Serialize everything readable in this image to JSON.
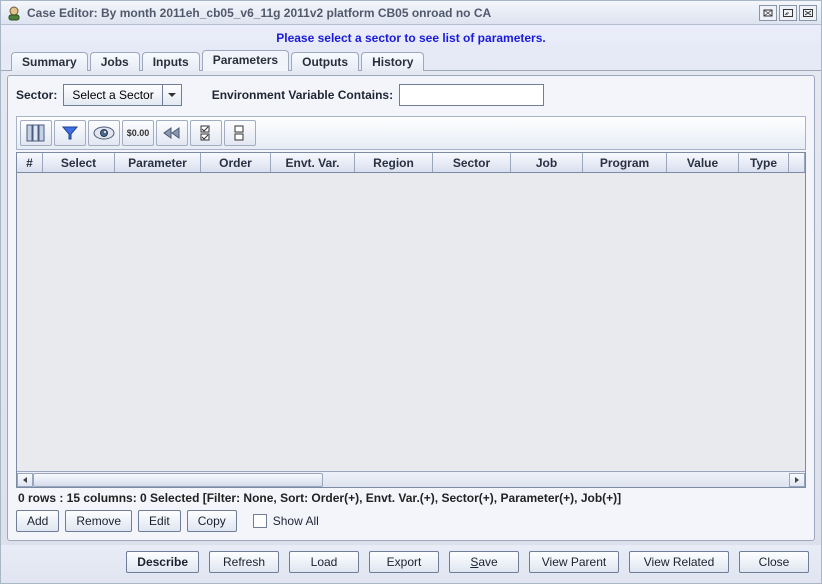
{
  "title": "Case Editor: By month 2011eh_cb05_v6_11g 2011v2 platform CB05 onroad no CA",
  "banner": "Please select a sector to see list of parameters.",
  "tabs": [
    {
      "label": "Summary"
    },
    {
      "label": "Jobs"
    },
    {
      "label": "Inputs"
    },
    {
      "label": "Parameters",
      "active": true
    },
    {
      "label": "Outputs"
    },
    {
      "label": "History"
    }
  ],
  "sectorRow": {
    "label": "Sector:",
    "comboText": "Select a Sector",
    "envLabel": "Environment Variable Contains:",
    "envValue": ""
  },
  "tableHeaders": [
    "#",
    "Select",
    "Parameter",
    "Order",
    "Envt. Var.",
    "Region",
    "Sector",
    "Job",
    "Program",
    "Value",
    "Type"
  ],
  "statusLine": "0 rows : 15 columns: 0 Selected [Filter: None, Sort: Order(+), Envt. Var.(+), Sector(+), Parameter(+), Job(+)]",
  "rowButtons": {
    "add": "Add",
    "remove": "Remove",
    "edit": "Edit",
    "copy": "Copy",
    "showAll": "Show All"
  },
  "bottomButtons": {
    "describe": "Describe",
    "refresh": "Refresh",
    "load": "Load",
    "export": "Export",
    "save": "Save",
    "saveMnemonic": "S",
    "viewParent": "View Parent",
    "viewRelated": "View Related",
    "close": "Close"
  }
}
